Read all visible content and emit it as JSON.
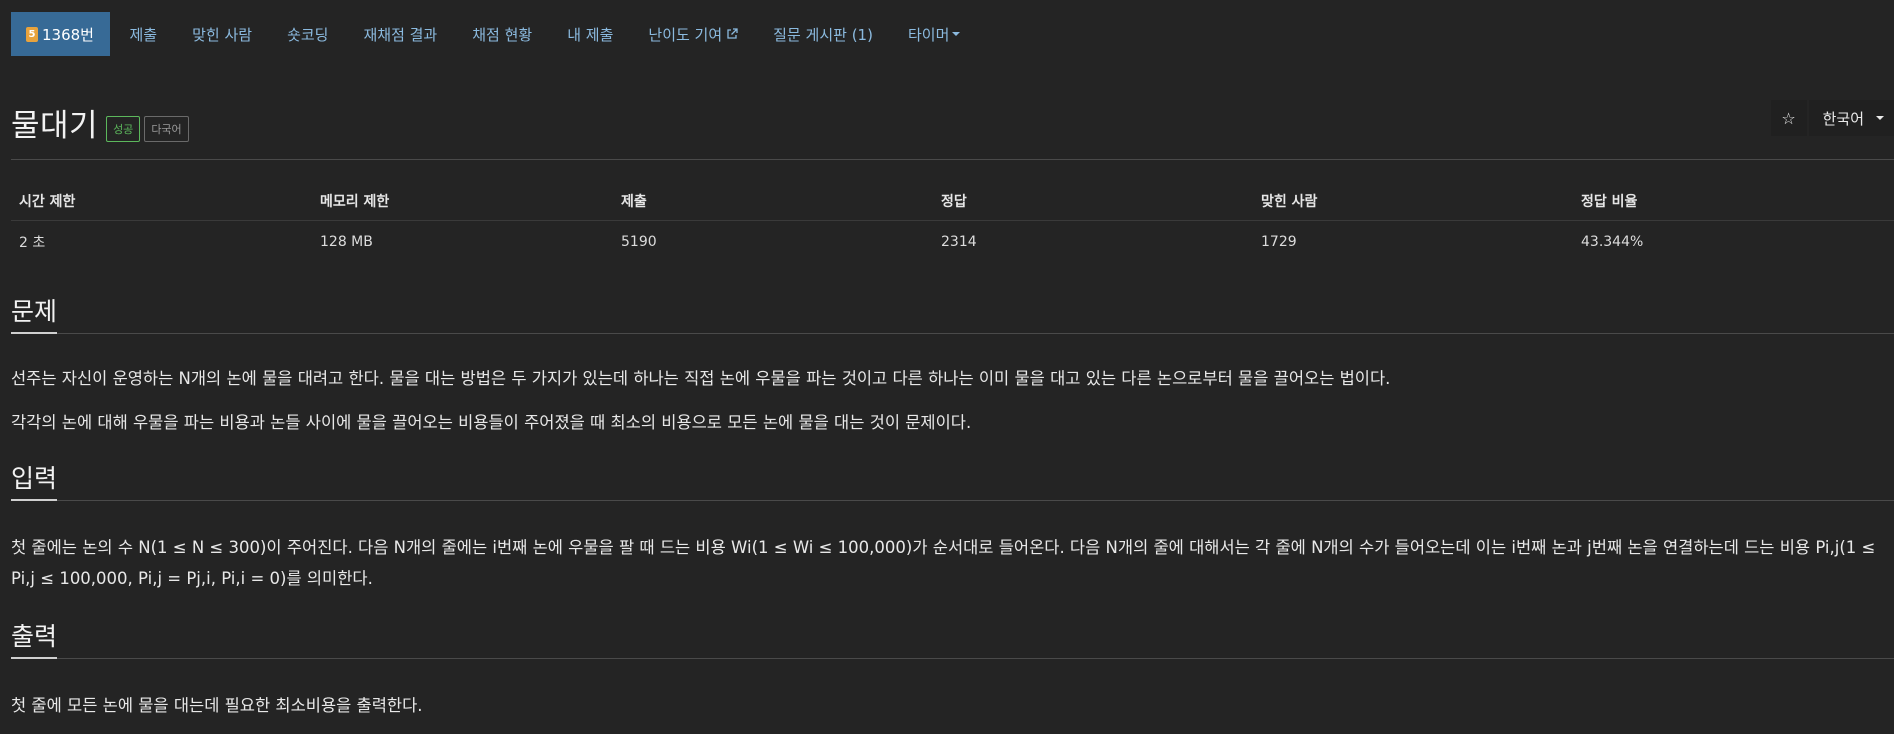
{
  "nav": {
    "items": [
      {
        "label": "1368번",
        "badge": "5",
        "active": true
      },
      {
        "label": "제출"
      },
      {
        "label": "맞힌 사람"
      },
      {
        "label": "숏코딩"
      },
      {
        "label": "재채점 결과"
      },
      {
        "label": "채점 현황"
      },
      {
        "label": "내 제출"
      },
      {
        "label": "난이도 기여",
        "icon": "external-link-icon"
      },
      {
        "label": "질문 게시판 (1)"
      },
      {
        "label": "타이머",
        "icon": "caret-down-icon"
      }
    ]
  },
  "problem": {
    "title": "물대기",
    "labels": {
      "success": "성공",
      "multilang": "다국어"
    }
  },
  "toolbar": {
    "star": "☆",
    "language": "한국어"
  },
  "stats": {
    "headers": [
      "시간 제한",
      "메모리 제한",
      "제출",
      "정답",
      "맞힌 사람",
      "정답 비율"
    ],
    "values": [
      "2 초",
      "128 MB",
      "5190",
      "2314",
      "1729",
      "43.344%"
    ]
  },
  "sections": {
    "problem": {
      "title": "문제",
      "paragraphs": [
        "선주는 자신이 운영하는 N개의 논에 물을 대려고 한다. 물을 대는 방법은 두 가지가 있는데 하나는 직접 논에 우물을 파는 것이고 다른 하나는 이미 물을 대고 있는 다른 논으로부터 물을 끌어오는 법이다.",
        "각각의 논에 대해 우물을 파는 비용과 논들 사이에 물을 끌어오는 비용들이 주어졌을 때 최소의 비용으로 모든 논에 물을 대는 것이 문제이다."
      ]
    },
    "input": {
      "title": "입력",
      "paragraph": "첫 줄에는 논의 수 N(1 ≤ N ≤ 300)이 주어진다. 다음 N개의 줄에는 i번째 논에 우물을 팔 때 드는 비용 Wi(1 ≤ Wi ≤ 100,000)가 순서대로 들어온다. 다음 N개의 줄에 대해서는 각 줄에 N개의 수가 들어오는데 이는 i번째 논과 j번째 논을 연결하는데 드는 비용 Pi,j(1 ≤ Pi,j ≤ 100,000, Pi,j = Pj,i, Pi,i = 0)를 의미한다."
    },
    "output": {
      "title": "출력",
      "paragraph": "첫 줄에 모든 논에 물을 대는데 필요한 최소비용을 출력한다."
    }
  },
  "colors": {
    "background": "#242424",
    "nav_link": "#8bbadf",
    "nav_active_bg": "#376a96",
    "success": "#5cb85c",
    "tier_badge": "#e8a33d"
  }
}
